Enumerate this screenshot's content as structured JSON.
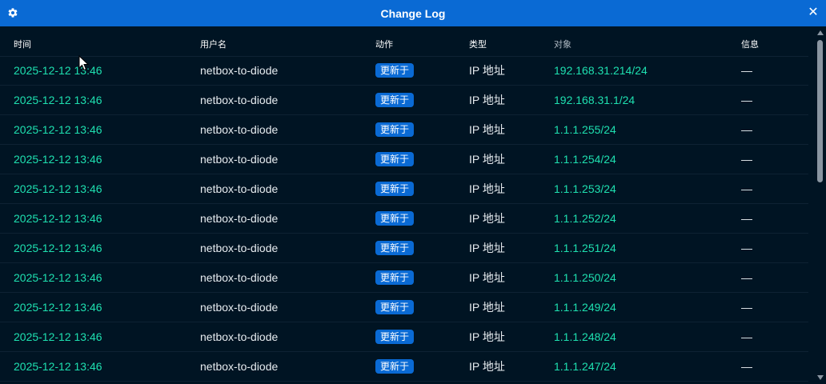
{
  "window": {
    "title": "Change Log",
    "close_glyph": "✕",
    "settings_icon": "gear-icon",
    "close_icon": "close-icon"
  },
  "colors": {
    "titlebar": "#0a6ad4",
    "background": "#001423",
    "accent_text": "#1ee0b0",
    "badge": "#0a6ad4"
  },
  "table": {
    "headers": {
      "time": "时间",
      "user": "用户名",
      "action": "动作",
      "type": "类型",
      "object": "对象",
      "message": "信息"
    },
    "rows": [
      {
        "time": "2025-12-12 13:46",
        "user": "netbox-to-diode",
        "action": "更新于",
        "type": "IP 地址",
        "object": "192.168.31.214/24",
        "message": "—"
      },
      {
        "time": "2025-12-12 13:46",
        "user": "netbox-to-diode",
        "action": "更新于",
        "type": "IP 地址",
        "object": "192.168.31.1/24",
        "message": "—"
      },
      {
        "time": "2025-12-12 13:46",
        "user": "netbox-to-diode",
        "action": "更新于",
        "type": "IP 地址",
        "object": "1.1.1.255/24",
        "message": "—"
      },
      {
        "time": "2025-12-12 13:46",
        "user": "netbox-to-diode",
        "action": "更新于",
        "type": "IP 地址",
        "object": "1.1.1.254/24",
        "message": "—"
      },
      {
        "time": "2025-12-12 13:46",
        "user": "netbox-to-diode",
        "action": "更新于",
        "type": "IP 地址",
        "object": "1.1.1.253/24",
        "message": "—"
      },
      {
        "time": "2025-12-12 13:46",
        "user": "netbox-to-diode",
        "action": "更新于",
        "type": "IP 地址",
        "object": "1.1.1.252/24",
        "message": "—"
      },
      {
        "time": "2025-12-12 13:46",
        "user": "netbox-to-diode",
        "action": "更新于",
        "type": "IP 地址",
        "object": "1.1.1.251/24",
        "message": "—"
      },
      {
        "time": "2025-12-12 13:46",
        "user": "netbox-to-diode",
        "action": "更新于",
        "type": "IP 地址",
        "object": "1.1.1.250/24",
        "message": "—"
      },
      {
        "time": "2025-12-12 13:46",
        "user": "netbox-to-diode",
        "action": "更新于",
        "type": "IP 地址",
        "object": "1.1.1.249/24",
        "message": "—"
      },
      {
        "time": "2025-12-12 13:46",
        "user": "netbox-to-diode",
        "action": "更新于",
        "type": "IP 地址",
        "object": "1.1.1.248/24",
        "message": "—"
      },
      {
        "time": "2025-12-12 13:46",
        "user": "netbox-to-diode",
        "action": "更新于",
        "type": "IP 地址",
        "object": "1.1.1.247/24",
        "message": "—"
      }
    ]
  }
}
